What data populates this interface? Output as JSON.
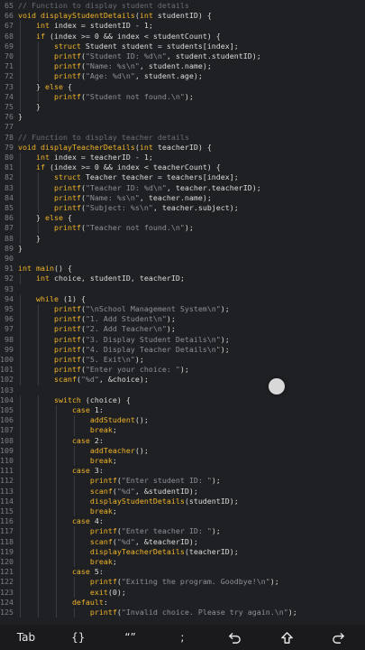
{
  "editor": {
    "lines": [
      {
        "n": "65",
        "segs": [
          [
            "c",
            "// Function to display student details"
          ]
        ]
      },
      {
        "n": "66",
        "segs": [
          [
            "k",
            "void "
          ],
          [
            "f",
            "displayStudentDetails"
          ],
          [
            "n",
            "("
          ],
          [
            "k",
            "int"
          ],
          [
            "n",
            " studentID) {"
          ]
        ]
      },
      {
        "n": "67",
        "segs": [
          [
            "k",
            "    int"
          ],
          [
            "n",
            " index = studentID - 1;"
          ]
        ]
      },
      {
        "n": "68",
        "segs": [
          [
            "k",
            "    if"
          ],
          [
            "n",
            " (index >= 0 && index < studentCount) {"
          ]
        ]
      },
      {
        "n": "69",
        "segs": [
          [
            "k",
            "        struct"
          ],
          [
            "n",
            " Student student = students[index];"
          ]
        ]
      },
      {
        "n": "70",
        "segs": [
          [
            "f",
            "        printf"
          ],
          [
            "n",
            "("
          ],
          [
            "s",
            "\"Student ID: %d\\n\""
          ],
          [
            "n",
            ", student.studentID);"
          ]
        ]
      },
      {
        "n": "71",
        "segs": [
          [
            "f",
            "        printf"
          ],
          [
            "n",
            "("
          ],
          [
            "s",
            "\"Name: %s\\n\""
          ],
          [
            "n",
            ", student.name);"
          ]
        ]
      },
      {
        "n": "72",
        "segs": [
          [
            "f",
            "        printf"
          ],
          [
            "n",
            "("
          ],
          [
            "s",
            "\"Age: %d\\n\""
          ],
          [
            "n",
            ", student.age);"
          ]
        ]
      },
      {
        "n": "73",
        "segs": [
          [
            "n",
            "    } "
          ],
          [
            "k",
            "else"
          ],
          [
            "n",
            " {"
          ]
        ]
      },
      {
        "n": "74",
        "segs": [
          [
            "f",
            "        printf"
          ],
          [
            "n",
            "("
          ],
          [
            "s",
            "\"Student not found.\\n\""
          ],
          [
            "n",
            ");"
          ]
        ]
      },
      {
        "n": "75",
        "segs": [
          [
            "n",
            "    }"
          ]
        ]
      },
      {
        "n": "76",
        "segs": [
          [
            "n",
            "}"
          ]
        ]
      },
      {
        "n": "77",
        "segs": []
      },
      {
        "n": "78",
        "segs": [
          [
            "c",
            "// Function to display teacher details"
          ]
        ]
      },
      {
        "n": "79",
        "segs": [
          [
            "k",
            "void "
          ],
          [
            "f",
            "displayTeacherDetails"
          ],
          [
            "n",
            "("
          ],
          [
            "k",
            "int"
          ],
          [
            "n",
            " teacherID) {"
          ]
        ]
      },
      {
        "n": "80",
        "segs": [
          [
            "k",
            "    int"
          ],
          [
            "n",
            " index = teacherID - 1;"
          ]
        ]
      },
      {
        "n": "81",
        "segs": [
          [
            "k",
            "    if"
          ],
          [
            "n",
            " (index >= 0 && index < teacherCount) {"
          ]
        ]
      },
      {
        "n": "82",
        "segs": [
          [
            "k",
            "        struct"
          ],
          [
            "n",
            " Teacher teacher = teachers[index];"
          ]
        ]
      },
      {
        "n": "83",
        "segs": [
          [
            "f",
            "        printf"
          ],
          [
            "n",
            "("
          ],
          [
            "s",
            "\"Teacher ID: %d\\n\""
          ],
          [
            "n",
            ", teacher.teacherID);"
          ]
        ]
      },
      {
        "n": "84",
        "segs": [
          [
            "f",
            "        printf"
          ],
          [
            "n",
            "("
          ],
          [
            "s",
            "\"Name: %s\\n\""
          ],
          [
            "n",
            ", teacher.name);"
          ]
        ]
      },
      {
        "n": "85",
        "segs": [
          [
            "f",
            "        printf"
          ],
          [
            "n",
            "("
          ],
          [
            "s",
            "\"Subject: %s\\n\""
          ],
          [
            "n",
            ", teacher.subject);"
          ]
        ]
      },
      {
        "n": "86",
        "segs": [
          [
            "n",
            "    } "
          ],
          [
            "k",
            "else"
          ],
          [
            "n",
            " {"
          ]
        ]
      },
      {
        "n": "87",
        "segs": [
          [
            "f",
            "        printf"
          ],
          [
            "n",
            "("
          ],
          [
            "s",
            "\"Teacher not found.\\n\""
          ],
          [
            "n",
            ");"
          ]
        ]
      },
      {
        "n": "88",
        "segs": [
          [
            "n",
            "    }"
          ]
        ]
      },
      {
        "n": "89",
        "segs": [
          [
            "n",
            "}"
          ]
        ]
      },
      {
        "n": "90",
        "segs": []
      },
      {
        "n": "91",
        "segs": [
          [
            "k",
            "int "
          ],
          [
            "f",
            "main"
          ],
          [
            "n",
            "() {"
          ]
        ]
      },
      {
        "n": "92",
        "segs": [
          [
            "k",
            "    int"
          ],
          [
            "n",
            " choice, studentID, teacherID;"
          ]
        ]
      },
      {
        "n": "93",
        "segs": []
      },
      {
        "n": "94",
        "segs": [
          [
            "k",
            "    while"
          ],
          [
            "n",
            " (1) {"
          ]
        ]
      },
      {
        "n": "95",
        "segs": [
          [
            "f",
            "        printf"
          ],
          [
            "n",
            "("
          ],
          [
            "s",
            "\"\\nSchool Management System\\n\""
          ],
          [
            "n",
            ");"
          ]
        ]
      },
      {
        "n": "96",
        "segs": [
          [
            "f",
            "        printf"
          ],
          [
            "n",
            "("
          ],
          [
            "s",
            "\"1. Add Student\\n\""
          ],
          [
            "n",
            ");"
          ]
        ]
      },
      {
        "n": "97",
        "segs": [
          [
            "f",
            "        printf"
          ],
          [
            "n",
            "("
          ],
          [
            "s",
            "\"2. Add Teacher\\n\""
          ],
          [
            "n",
            ");"
          ]
        ]
      },
      {
        "n": "98",
        "segs": [
          [
            "f",
            "        printf"
          ],
          [
            "n",
            "("
          ],
          [
            "s",
            "\"3. Display Student Details\\n\""
          ],
          [
            "n",
            ");"
          ]
        ]
      },
      {
        "n": "99",
        "segs": [
          [
            "f",
            "        printf"
          ],
          [
            "n",
            "("
          ],
          [
            "s",
            "\"4. Display Teacher Details\\n\""
          ],
          [
            "n",
            ");"
          ]
        ]
      },
      {
        "n": "100",
        "segs": [
          [
            "f",
            "        printf"
          ],
          [
            "n",
            "("
          ],
          [
            "s",
            "\"5. Exit\\n\""
          ],
          [
            "n",
            ");"
          ]
        ]
      },
      {
        "n": "101",
        "segs": [
          [
            "f",
            "        printf"
          ],
          [
            "n",
            "("
          ],
          [
            "s",
            "\"Enter your choice: \""
          ],
          [
            "n",
            ");"
          ]
        ]
      },
      {
        "n": "102",
        "segs": [
          [
            "f",
            "        scanf"
          ],
          [
            "n",
            "("
          ],
          [
            "s",
            "\"%d\""
          ],
          [
            "n",
            ", &choice);"
          ]
        ]
      },
      {
        "n": "103",
        "segs": []
      },
      {
        "n": "104",
        "segs": [
          [
            "k",
            "        switch"
          ],
          [
            "n",
            " (choice) {"
          ]
        ]
      },
      {
        "n": "105",
        "segs": [
          [
            "k",
            "            case"
          ],
          [
            "n",
            " 1:"
          ]
        ]
      },
      {
        "n": "106",
        "segs": [
          [
            "f",
            "                addStudent"
          ],
          [
            "n",
            "();"
          ]
        ]
      },
      {
        "n": "107",
        "segs": [
          [
            "k",
            "                break"
          ],
          [
            "n",
            ";"
          ]
        ]
      },
      {
        "n": "108",
        "segs": [
          [
            "k",
            "            case"
          ],
          [
            "n",
            " 2:"
          ]
        ]
      },
      {
        "n": "109",
        "segs": [
          [
            "f",
            "                addTeacher"
          ],
          [
            "n",
            "();"
          ]
        ]
      },
      {
        "n": "110",
        "segs": [
          [
            "k",
            "                break"
          ],
          [
            "n",
            ";"
          ]
        ]
      },
      {
        "n": "111",
        "segs": [
          [
            "k",
            "            case"
          ],
          [
            "n",
            " 3:"
          ]
        ]
      },
      {
        "n": "112",
        "segs": [
          [
            "f",
            "                printf"
          ],
          [
            "n",
            "("
          ],
          [
            "s",
            "\"Enter student ID: \""
          ],
          [
            "n",
            ");"
          ]
        ]
      },
      {
        "n": "113",
        "segs": [
          [
            "f",
            "                scanf"
          ],
          [
            "n",
            "("
          ],
          [
            "s",
            "\"%d\""
          ],
          [
            "n",
            ", &studentID);"
          ]
        ]
      },
      {
        "n": "114",
        "segs": [
          [
            "f",
            "                displayStudentDetails"
          ],
          [
            "n",
            "(studentID);"
          ]
        ]
      },
      {
        "n": "115",
        "segs": [
          [
            "k",
            "                break"
          ],
          [
            "n",
            ";"
          ]
        ]
      },
      {
        "n": "116",
        "segs": [
          [
            "k",
            "            case"
          ],
          [
            "n",
            " 4:"
          ]
        ]
      },
      {
        "n": "117",
        "segs": [
          [
            "f",
            "                printf"
          ],
          [
            "n",
            "("
          ],
          [
            "s",
            "\"Enter teacher ID: \""
          ],
          [
            "n",
            ");"
          ]
        ]
      },
      {
        "n": "118",
        "segs": [
          [
            "f",
            "                scanf"
          ],
          [
            "n",
            "("
          ],
          [
            "s",
            "\"%d\""
          ],
          [
            "n",
            ", &teacherID);"
          ]
        ]
      },
      {
        "n": "119",
        "segs": [
          [
            "f",
            "                displayTeacherDetails"
          ],
          [
            "n",
            "(teacherID);"
          ]
        ]
      },
      {
        "n": "120",
        "segs": [
          [
            "k",
            "                break"
          ],
          [
            "n",
            ";"
          ]
        ]
      },
      {
        "n": "121",
        "segs": [
          [
            "k",
            "            case"
          ],
          [
            "n",
            " 5:"
          ]
        ]
      },
      {
        "n": "122",
        "segs": [
          [
            "f",
            "                printf"
          ],
          [
            "n",
            "("
          ],
          [
            "s",
            "\"Exiting the program. Goodbye!\\n\""
          ],
          [
            "n",
            ");"
          ]
        ]
      },
      {
        "n": "123",
        "segs": [
          [
            "f",
            "                exit"
          ],
          [
            "n",
            "(0);"
          ]
        ]
      },
      {
        "n": "124",
        "segs": [
          [
            "k",
            "            default"
          ],
          [
            "n",
            ":"
          ]
        ]
      },
      {
        "n": "125",
        "segs": [
          [
            "f",
            "                printf"
          ],
          [
            "n",
            "("
          ],
          [
            "s",
            "\"Invalid choice. Please try again.\\n\""
          ],
          [
            "n",
            ");"
          ]
        ]
      }
    ]
  },
  "toolbar": {
    "tab_label": "Tab",
    "braces_label": "{}",
    "quotes_label": "“”",
    "semicolon_label": ";",
    "undo_icon": "undo-icon",
    "shift_icon": "shift-up-arrow-icon",
    "redo_icon": "redo-icon"
  },
  "colors": {
    "background": "#1f2023",
    "keyword": "#f0b428",
    "string": "#8f9096",
    "comment": "#6b6d73",
    "text": "#dcdcdc",
    "line_number": "#7d7f84"
  }
}
